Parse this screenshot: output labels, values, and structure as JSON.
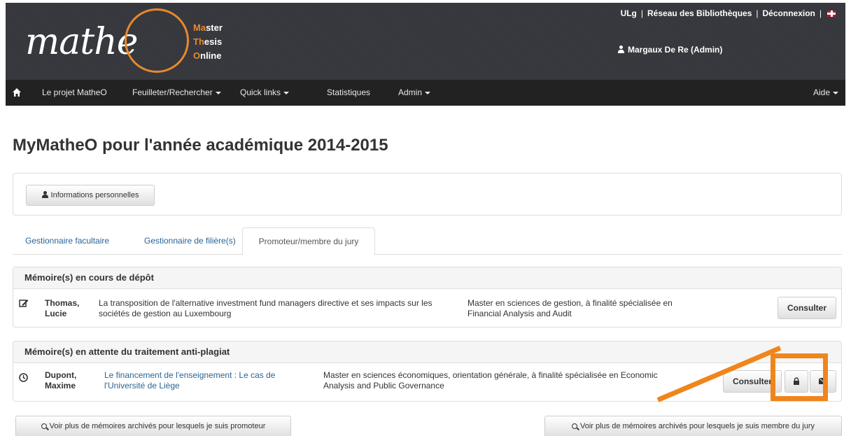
{
  "app": {
    "logo_text": "mathe",
    "logo_line1_hl": "Ma",
    "logo_line1_rest": "ster",
    "logo_line2_hl": "Th",
    "logo_line2_rest": "esis",
    "logo_line3_hl": "O",
    "logo_line3_rest": "nline"
  },
  "toplinks": {
    "ulg": "ULg",
    "libraries": "Réseau des Bibliothèques",
    "logout": "Déconnexion",
    "flag": "uk-flag-icon"
  },
  "user": {
    "name": "Margaux De Re (Admin)"
  },
  "nav": {
    "home_icon": "home-icon",
    "project": "Le projet MatheO",
    "browse": "Feuilleter/Rechercher",
    "quicklinks": "Quick links",
    "stats": "Statistiques",
    "admin": "Admin",
    "help": "Aide"
  },
  "page": {
    "title": "MyMatheO pour l'année académique 2014-2015"
  },
  "info": {
    "button_label": "Informations personnelles"
  },
  "tabs": [
    {
      "label": "Gestionnaire facultaire"
    },
    {
      "label": "Gestionnaire de filière(s)"
    },
    {
      "label": "Promoteur/membre du jury"
    }
  ],
  "panel1": {
    "title": "Mémoire(s) en cours de dépôt",
    "row": {
      "icon": "edit-icon",
      "name_line1": "Thomas,",
      "name_line2": "Lucie",
      "title_line1": "La transposition de l'alternative investment fund managers directive et ses impacts sur les",
      "title_line2": "sociétés de gestion au Luxembourg",
      "program_line1": "Master en sciences de gestion, à finalité spécialisée en",
      "program_line2": "Financial Analysis and Audit",
      "button": "Consulter"
    }
  },
  "panel2": {
    "title": "Mémoire(s) en attente du traitement anti-plagiat",
    "row": {
      "icon": "clock-icon",
      "name_line1": "Dupont,",
      "name_line2": "Maxime",
      "title_line1": "Le financement de l'enseignement : Le cas de",
      "title_line2": "l'Université de Liège",
      "program_line1": "Master en sciences économiques, orientation générale, à finalité spécialisée en Economic",
      "program_line2": "Analysis and Public Governance",
      "button": "Consulter",
      "lock_icon": "lock-icon",
      "mail_icon": "envelope-icon"
    }
  },
  "footer": {
    "promoter_btn": "Voir plus de mémoires archivés pour lesquels je suis promoteur",
    "jury_btn": "Voir plus de mémoires archivés pour lesquels je suis membre du jury"
  },
  "colors": {
    "accent": "#f0851c",
    "header": "#3a3b40",
    "navbar": "#222222",
    "link": "#2a6496"
  }
}
